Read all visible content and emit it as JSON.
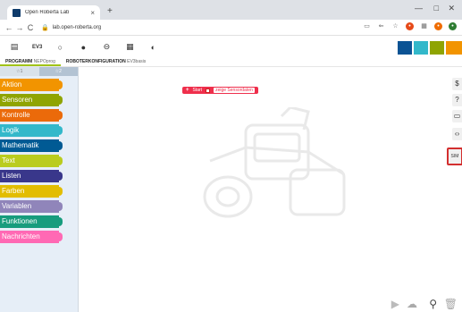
{
  "browser": {
    "tab_title": "Open Roberta Lab",
    "tab_close": "×",
    "new_tab": "+",
    "win_min": "—",
    "win_max": "□",
    "win_close": "✕",
    "back": "←",
    "forward": "→",
    "reload": "C",
    "lock": "🔒",
    "url": "lab.open-roberta.org"
  },
  "toolbar": {
    "robot_label": "EV3"
  },
  "program_tabs": [
    {
      "title": "PROGRAMM",
      "subtitle": "NEPOprog"
    },
    {
      "title": "ROBOTERKONFIGURATION",
      "subtitle": "EV3basis"
    }
  ],
  "palette": {
    "levels": [
      "☆1",
      "☆2"
    ],
    "categories": [
      {
        "label": "Aktion",
        "color": "#F29400"
      },
      {
        "label": "Sensoren",
        "color": "#8FA402"
      },
      {
        "label": "Kontrolle",
        "color": "#EB6A0A"
      },
      {
        "label": "Logik",
        "color": "#33B8CA"
      },
      {
        "label": "Mathematik",
        "color": "#005A94"
      },
      {
        "label": "Text",
        "color": "#BACC1E"
      },
      {
        "label": "Listen",
        "color": "#39378B"
      },
      {
        "label": "Farben",
        "color": "#E2BD01"
      },
      {
        "label": "Variablen",
        "color": "#9085BA"
      },
      {
        "label": "Funktionen",
        "color": "#179C7D"
      },
      {
        "label": "Nachrichten",
        "color": "#FF69B4"
      }
    ]
  },
  "start_block": {
    "label": "Start",
    "checkbox_label": "zeige Sensordaten"
  },
  "right_tools": [
    {
      "symbol": "$",
      "name": "code-icon"
    },
    {
      "symbol": "?",
      "name": "help-icon"
    },
    {
      "symbol": "▭",
      "name": "info-icon"
    },
    {
      "symbol": "‹›",
      "name": "code-view-icon"
    },
    {
      "symbol": "SIM",
      "name": "simulation-icon"
    }
  ],
  "bottom_icons": {
    "run": "▶",
    "upload": "☁",
    "zoom": "⚲",
    "trash": "🗑"
  }
}
